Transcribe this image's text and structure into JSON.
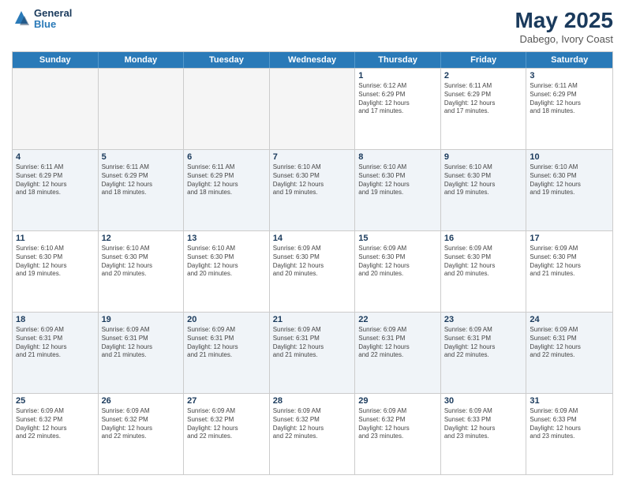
{
  "header": {
    "logo": {
      "general": "General",
      "blue": "Blue"
    },
    "title": "May 2025",
    "location": "Dabego, Ivory Coast"
  },
  "days": [
    "Sunday",
    "Monday",
    "Tuesday",
    "Wednesday",
    "Thursday",
    "Friday",
    "Saturday"
  ],
  "weeks": [
    [
      {
        "day": "",
        "empty": true,
        "info": ""
      },
      {
        "day": "",
        "empty": true,
        "info": ""
      },
      {
        "day": "",
        "empty": true,
        "info": ""
      },
      {
        "day": "",
        "empty": true,
        "info": ""
      },
      {
        "day": "1",
        "empty": false,
        "info": "Sunrise: 6:12 AM\nSunset: 6:29 PM\nDaylight: 12 hours\nand 17 minutes."
      },
      {
        "day": "2",
        "empty": false,
        "info": "Sunrise: 6:11 AM\nSunset: 6:29 PM\nDaylight: 12 hours\nand 17 minutes."
      },
      {
        "day": "3",
        "empty": false,
        "info": "Sunrise: 6:11 AM\nSunset: 6:29 PM\nDaylight: 12 hours\nand 18 minutes."
      }
    ],
    [
      {
        "day": "4",
        "empty": false,
        "info": "Sunrise: 6:11 AM\nSunset: 6:29 PM\nDaylight: 12 hours\nand 18 minutes."
      },
      {
        "day": "5",
        "empty": false,
        "info": "Sunrise: 6:11 AM\nSunset: 6:29 PM\nDaylight: 12 hours\nand 18 minutes."
      },
      {
        "day": "6",
        "empty": false,
        "info": "Sunrise: 6:11 AM\nSunset: 6:29 PM\nDaylight: 12 hours\nand 18 minutes."
      },
      {
        "day": "7",
        "empty": false,
        "info": "Sunrise: 6:10 AM\nSunset: 6:30 PM\nDaylight: 12 hours\nand 19 minutes."
      },
      {
        "day": "8",
        "empty": false,
        "info": "Sunrise: 6:10 AM\nSunset: 6:30 PM\nDaylight: 12 hours\nand 19 minutes."
      },
      {
        "day": "9",
        "empty": false,
        "info": "Sunrise: 6:10 AM\nSunset: 6:30 PM\nDaylight: 12 hours\nand 19 minutes."
      },
      {
        "day": "10",
        "empty": false,
        "info": "Sunrise: 6:10 AM\nSunset: 6:30 PM\nDaylight: 12 hours\nand 19 minutes."
      }
    ],
    [
      {
        "day": "11",
        "empty": false,
        "info": "Sunrise: 6:10 AM\nSunset: 6:30 PM\nDaylight: 12 hours\nand 19 minutes."
      },
      {
        "day": "12",
        "empty": false,
        "info": "Sunrise: 6:10 AM\nSunset: 6:30 PM\nDaylight: 12 hours\nand 20 minutes."
      },
      {
        "day": "13",
        "empty": false,
        "info": "Sunrise: 6:10 AM\nSunset: 6:30 PM\nDaylight: 12 hours\nand 20 minutes."
      },
      {
        "day": "14",
        "empty": false,
        "info": "Sunrise: 6:09 AM\nSunset: 6:30 PM\nDaylight: 12 hours\nand 20 minutes."
      },
      {
        "day": "15",
        "empty": false,
        "info": "Sunrise: 6:09 AM\nSunset: 6:30 PM\nDaylight: 12 hours\nand 20 minutes."
      },
      {
        "day": "16",
        "empty": false,
        "info": "Sunrise: 6:09 AM\nSunset: 6:30 PM\nDaylight: 12 hours\nand 20 minutes."
      },
      {
        "day": "17",
        "empty": false,
        "info": "Sunrise: 6:09 AM\nSunset: 6:30 PM\nDaylight: 12 hours\nand 21 minutes."
      }
    ],
    [
      {
        "day": "18",
        "empty": false,
        "info": "Sunrise: 6:09 AM\nSunset: 6:31 PM\nDaylight: 12 hours\nand 21 minutes."
      },
      {
        "day": "19",
        "empty": false,
        "info": "Sunrise: 6:09 AM\nSunset: 6:31 PM\nDaylight: 12 hours\nand 21 minutes."
      },
      {
        "day": "20",
        "empty": false,
        "info": "Sunrise: 6:09 AM\nSunset: 6:31 PM\nDaylight: 12 hours\nand 21 minutes."
      },
      {
        "day": "21",
        "empty": false,
        "info": "Sunrise: 6:09 AM\nSunset: 6:31 PM\nDaylight: 12 hours\nand 21 minutes."
      },
      {
        "day": "22",
        "empty": false,
        "info": "Sunrise: 6:09 AM\nSunset: 6:31 PM\nDaylight: 12 hours\nand 22 minutes."
      },
      {
        "day": "23",
        "empty": false,
        "info": "Sunrise: 6:09 AM\nSunset: 6:31 PM\nDaylight: 12 hours\nand 22 minutes."
      },
      {
        "day": "24",
        "empty": false,
        "info": "Sunrise: 6:09 AM\nSunset: 6:31 PM\nDaylight: 12 hours\nand 22 minutes."
      }
    ],
    [
      {
        "day": "25",
        "empty": false,
        "info": "Sunrise: 6:09 AM\nSunset: 6:32 PM\nDaylight: 12 hours\nand 22 minutes."
      },
      {
        "day": "26",
        "empty": false,
        "info": "Sunrise: 6:09 AM\nSunset: 6:32 PM\nDaylight: 12 hours\nand 22 minutes."
      },
      {
        "day": "27",
        "empty": false,
        "info": "Sunrise: 6:09 AM\nSunset: 6:32 PM\nDaylight: 12 hours\nand 22 minutes."
      },
      {
        "day": "28",
        "empty": false,
        "info": "Sunrise: 6:09 AM\nSunset: 6:32 PM\nDaylight: 12 hours\nand 22 minutes."
      },
      {
        "day": "29",
        "empty": false,
        "info": "Sunrise: 6:09 AM\nSunset: 6:32 PM\nDaylight: 12 hours\nand 23 minutes."
      },
      {
        "day": "30",
        "empty": false,
        "info": "Sunrise: 6:09 AM\nSunset: 6:33 PM\nDaylight: 12 hours\nand 23 minutes."
      },
      {
        "day": "31",
        "empty": false,
        "info": "Sunrise: 6:09 AM\nSunset: 6:33 PM\nDaylight: 12 hours\nand 23 minutes."
      }
    ]
  ]
}
